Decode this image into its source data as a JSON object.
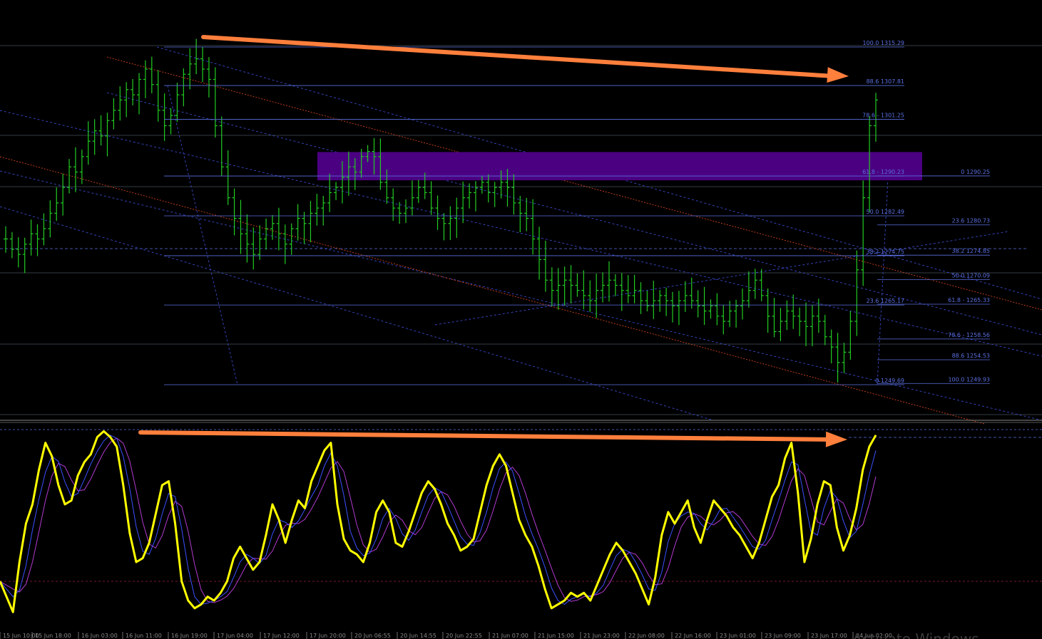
{
  "colors": {
    "background": "#000000",
    "bars": "#22cc22",
    "grid": "#5a6fe0",
    "channel_blue": "#3949c9",
    "channel_red": "#d2441c",
    "zone": "#4b0082",
    "arrow": "#ff7f3c",
    "stoch_main": "#ffff00",
    "stoch_blue": "#3b50ff",
    "stoch_purple": "#b23ad0"
  },
  "chart_data": [
    {
      "type": "ohlc",
      "ylim": [
        1249.69,
        1315.29
      ],
      "x_ticks": [
        "15 Jun 10:00",
        "15 Jun 18:00",
        "16 Jun 03:00",
        "16 Jun 11:00",
        "16 Jun 19:00",
        "17 Jun 04:00",
        "17 Jun 12:00",
        "17 Jun 20:00",
        "20 Jun 06:55",
        "20 Jun 14:55",
        "20 Jun 22:55",
        "21 Jun 07:00",
        "21 Jun 15:00",
        "21 Jun 23:00",
        "22 Jun 08:00",
        "22 Jun 16:00",
        "23 Jun 01:00",
        "23 Jun 09:00",
        "23 Jun 17:00",
        "24 Jun 02:00"
      ],
      "closes": [
        1278,
        1276,
        1275,
        1277,
        1279,
        1278,
        1280,
        1283,
        1285,
        1288,
        1292,
        1291,
        1294,
        1297,
        1299,
        1298,
        1301,
        1303,
        1305,
        1307,
        1306,
        1309,
        1311,
        1308,
        1303,
        1300,
        1302,
        1306,
        1310,
        1312,
        1313,
        1311,
        1309,
        1300,
        1292,
        1286,
        1282,
        1279,
        1277,
        1275,
        1278,
        1280,
        1281,
        1279,
        1277,
        1280,
        1282,
        1281,
        1283,
        1284,
        1285,
        1287,
        1288,
        1290,
        1292,
        1291,
        1294,
        1295,
        1294,
        1289,
        1286,
        1284,
        1283,
        1284,
        1286,
        1288,
        1287,
        1284,
        1282,
        1281,
        1282,
        1284,
        1286,
        1287,
        1288,
        1289,
        1287,
        1288,
        1289,
        1288,
        1285,
        1283,
        1282,
        1278,
        1274,
        1270,
        1268,
        1269,
        1270,
        1269,
        1268,
        1267,
        1266,
        1268,
        1269,
        1270,
        1269,
        1268,
        1267,
        1268,
        1266,
        1265,
        1266,
        1267,
        1266,
        1265,
        1266,
        1267,
        1266,
        1265,
        1264,
        1265,
        1263,
        1262,
        1264,
        1265,
        1266,
        1268,
        1270,
        1267,
        1263,
        1260,
        1262,
        1264,
        1263,
        1262,
        1261,
        1263,
        1262,
        1259,
        1257,
        1254,
        1256,
        1262,
        1272,
        1286,
        1300,
        1305
      ],
      "fib_left": [
        {
          "label": "100.0 1315.29",
          "value": 1315.29
        },
        {
          "label": "88.6 1307.81",
          "value": 1307.81
        },
        {
          "label": "78.6 - 1301.25",
          "value": 1301.25
        },
        {
          "label": "61.8 - 1290.23",
          "value": 1290.23
        },
        {
          "label": "50.0 1282.49",
          "value": 1282.49
        },
        {
          "label": "38.2 1274.75",
          "value": 1274.75
        },
        {
          "label": "23.6 1265.17",
          "value": 1265.17
        },
        {
          "label": "0 1249.69",
          "value": 1249.69
        }
      ],
      "fib_right": [
        {
          "label": "0 1290.25",
          "value": 1290.25
        },
        {
          "label": "23.6 1280.73",
          "value": 1280.73
        },
        {
          "label": "38.2 1274.85",
          "value": 1274.85
        },
        {
          "label": "50.0 1270.09",
          "value": 1270.09
        },
        {
          "label": "61.8 - 1265.33",
          "value": 1265.33
        },
        {
          "label": "78.6 - 1258.56",
          "value": 1258.56
        },
        {
          "label": "88.6 1254.53",
          "value": 1254.53
        },
        {
          "label": "100.0 1249.93",
          "value": 1249.93
        }
      ],
      "supply_zone": [
        1290.23,
        1293.5
      ]
    },
    {
      "type": "line",
      "name_hint": "stochastic",
      "ylim": [
        0,
        100
      ],
      "levels": [
        80,
        20
      ],
      "main": [
        20,
        12,
        4,
        30,
        50,
        60,
        78,
        92,
        85,
        70,
        60,
        62,
        75,
        82,
        86,
        95,
        98,
        95,
        90,
        70,
        45,
        30,
        32,
        40,
        55,
        70,
        72,
        50,
        20,
        10,
        6,
        8,
        12,
        10,
        14,
        20,
        32,
        38,
        32,
        26,
        30,
        44,
        60,
        52,
        40,
        52,
        62,
        58,
        72,
        80,
        88,
        92,
        60,
        42,
        36,
        34,
        30,
        40,
        56,
        62,
        56,
        40,
        38,
        46,
        56,
        66,
        72,
        68,
        60,
        50,
        44,
        36,
        38,
        42,
        56,
        70,
        80,
        86,
        80,
        66,
        52,
        44,
        38,
        28,
        16,
        6,
        8,
        10,
        14,
        12,
        14,
        10,
        18,
        26,
        34,
        40,
        36,
        30,
        24,
        16,
        8,
        22,
        44,
        56,
        50,
        56,
        62,
        48,
        40,
        52,
        62,
        58,
        54,
        48,
        44,
        38,
        32,
        40,
        52,
        64,
        70,
        84,
        92,
        66,
        30,
        42,
        60,
        72,
        70,
        48,
        36,
        44,
        58,
        78,
        90,
        96
      ]
    }
  ],
  "watermark": "Activate Windows"
}
